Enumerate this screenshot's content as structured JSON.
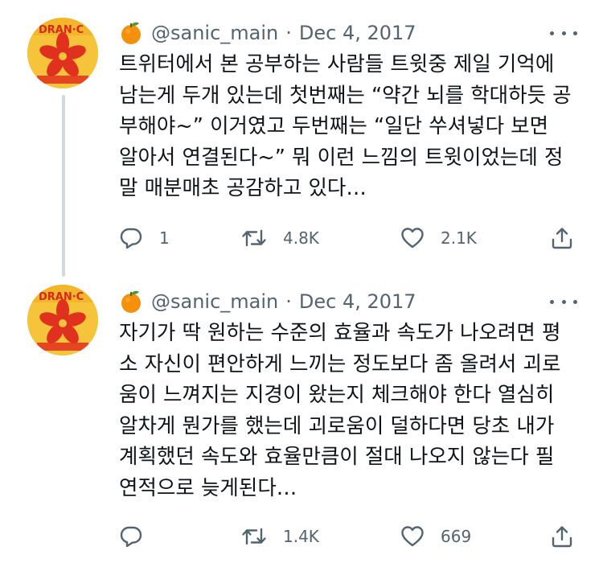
{
  "colors": {
    "text": "#0f1419",
    "secondary": "#536471",
    "thread_line": "#cfd9de",
    "avatar_background": "#f6c43a",
    "avatar_flower": "#e0301e"
  },
  "tweets": [
    {
      "avatar_icon": "orange-brand-avatar",
      "avatar_text": "DRAN·C",
      "header_emoji": "tangerine-emoji",
      "handle": "@sanic_main",
      "separator": "·",
      "date": "Dec 4, 2017",
      "more_icon": "more-dots-icon",
      "lines": [
        "트위터에서 본 공부하는 사람들 트윗중 제일 기억에",
        "남는게 두개 있는데 첫번째는 “약간 뇌를 학대하듯 공",
        "부해야~” 이거였고 두번째는 “일단 쑤셔넣다 보면",
        "알아서 연결된다~” 뭐 이런 느낌의 트윗이었는데 정",
        "말 매분매초 공감하고 있다…"
      ],
      "replies": "1",
      "retweets": "4.8K",
      "likes": "2.1K"
    },
    {
      "avatar_icon": "orange-brand-avatar",
      "avatar_text": "DRAN·C",
      "header_emoji": "tangerine-emoji",
      "handle": "@sanic_main",
      "separator": "·",
      "date": "Dec 4, 2017",
      "more_icon": "more-dots-icon",
      "lines": [
        "자기가 딱 원하는 수준의 효율과 속도가 나오려면 평",
        "소 자신이 편안하게 느끼는 정도보다 좀 올려서 괴로",
        "움이 느껴지는 지경이 왔는지 체크해야 한다 열심히",
        "알차게 뭔가를 했는데 괴로움이 덜하다면 당초 내가",
        "계획했던 속도와 효율만큼이 절대 나오지 않는다 필",
        "연적으로 늦게된다…"
      ],
      "replies": "",
      "retweets": "1.4K",
      "likes": "669"
    }
  ]
}
